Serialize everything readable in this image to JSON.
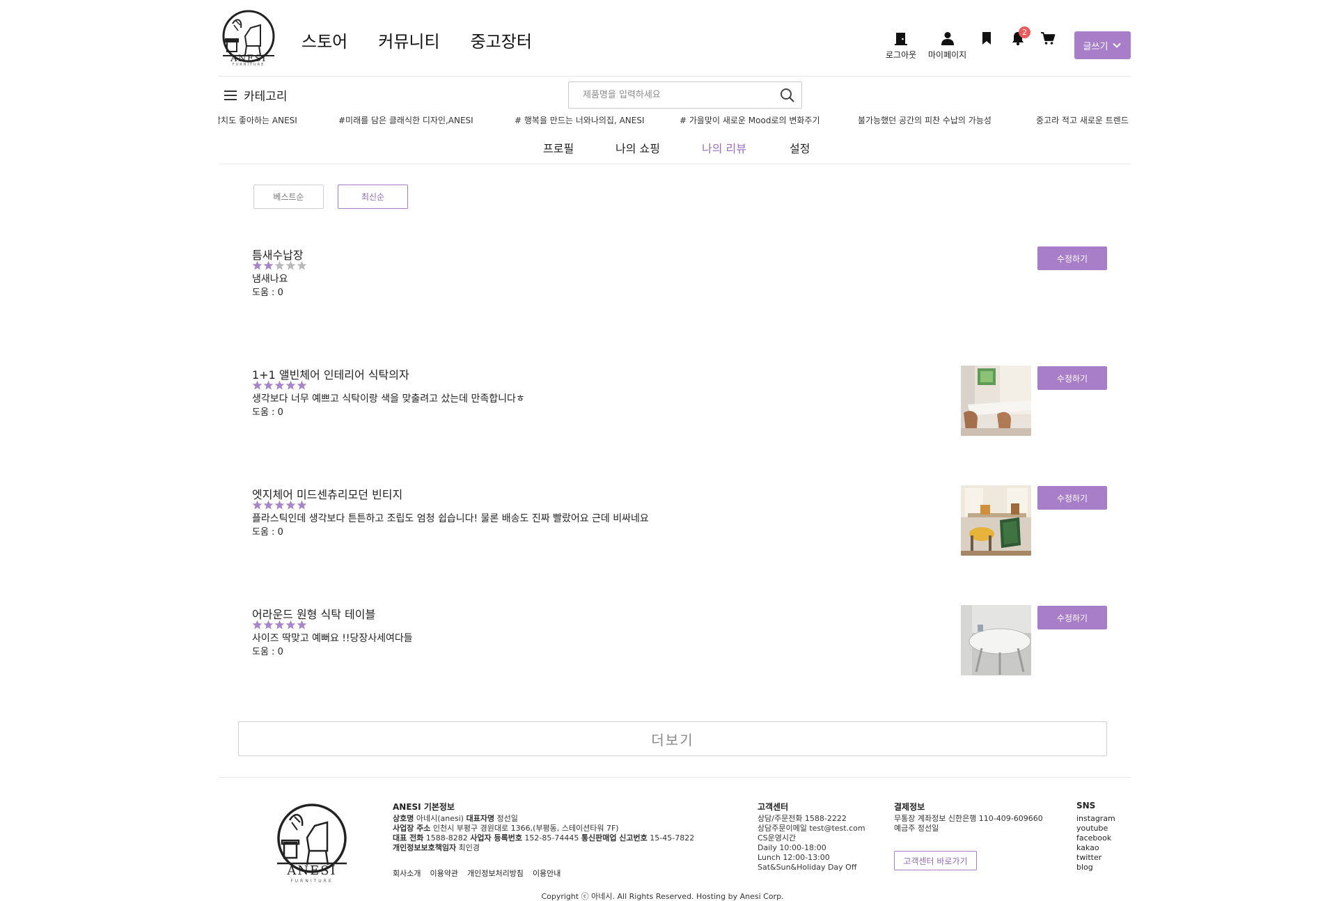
{
  "brand": {
    "logo_text": "ANESI",
    "logo_sub": "FURNITURE"
  },
  "nav": {
    "store": "스토어",
    "community": "커뮤니티",
    "used_market": "중고장터"
  },
  "utility": {
    "logout": "로그아웃",
    "mypage": "마이페이지",
    "notification_count": "2",
    "write": "글쓰기"
  },
  "category_label": "카테고리",
  "search": {
    "placeholder": "제품명을 입력하세요"
  },
  "ticker": [
    "갑치도 좋아하는 ANESI",
    "#미래를 담은 클래식한 디자인,ANESI",
    "# 행복을 만드는 너와나의집, ANESI",
    "# 가을맞이 새로운 Mood로의 변화주기",
    "불가능했던 공간의 피찬 수납의 가능성",
    "중고라 적고 새로운 트렌드"
  ],
  "mypage_tabs": [
    "프로필",
    "나의 쇼핑",
    "나의 리뷰",
    "설정"
  ],
  "sort": {
    "best": "베스트순",
    "latest": "최신순"
  },
  "reviews": [
    {
      "title": "틈새수납장",
      "rating": 2,
      "content": "냄새나요",
      "help": "도움 : 0",
      "edit": "수정하기",
      "has_image": false
    },
    {
      "title": "1+1 앨빈체어 인테리어 식탁의자",
      "rating": 5,
      "content": "생각보다 너무 예쁘고 식탁이랑 색을 맞출려고 샀는데 만족합니다ㅎ",
      "help": "도움 : 0",
      "edit": "수정하기",
      "has_image": true
    },
    {
      "title": "엣지체어 미드센츄리모던 빈티지",
      "rating": 5,
      "content": "플라스틱인데 생각보다 튼튼하고 조립도 엄청 쉽습니다! 물론 배송도 진짜 빨랐어요 근데 비싸네요",
      "help": "도움 : 0",
      "edit": "수정하기",
      "has_image": true
    },
    {
      "title": "어라운드 원형 식탁 테이블",
      "rating": 5,
      "content": "사이즈 딱맞고 예뻐요 !!당장사세여다들",
      "help": "도움 : 0",
      "edit": "수정하기",
      "has_image": true
    }
  ],
  "more_button": "더보기",
  "footer": {
    "company_heading": "ANESI 기본정보",
    "company_lines": [
      [
        [
          "b",
          "상호명"
        ],
        [
          "",
          " 아네시(anesi) "
        ],
        [
          "b",
          "대표자명"
        ],
        [
          "",
          " 정선일"
        ]
      ],
      [
        [
          "b",
          "사업장 주소"
        ],
        [
          "",
          " 인천시 부평구 경원대로 1366,(부평동, 스테이션타워 7F)"
        ]
      ],
      [
        [
          "b",
          "대표 전화"
        ],
        [
          "",
          " 1588-8282 "
        ],
        [
          "b",
          "사업자 등록번호"
        ],
        [
          "",
          " 152-85-74445 "
        ],
        [
          "b",
          "통신판매업 신고번호"
        ],
        [
          "",
          " 15-45-7822"
        ]
      ],
      [
        [
          "b",
          "개인정보보호책임자"
        ],
        [
          "",
          " 최인경"
        ]
      ]
    ],
    "links": [
      "회사소개",
      "이용약관",
      "개인정보처리방침",
      "이용안내"
    ],
    "cs_heading": "고객센터",
    "cs_lines": [
      "상담/주문전화 1588-2222",
      "상담주문이메일 test@test.com",
      "CS운영시간",
      "Daily 10:00-18:00",
      "Lunch 12:00-13:00",
      "Sat&Sun&Holiday Day Off"
    ],
    "pay_heading": "결제정보",
    "pay_lines": [
      "무통장 계좌정보 신한은행 110-409-609660",
      "예금주 정선일"
    ],
    "cs_button": "고객센터 바로가기",
    "sns_heading": "SNS",
    "sns": [
      "instagram",
      "youtube",
      "facebook",
      "kakao",
      "twitter",
      "blog"
    ],
    "copyright": "Copyright ⓒ 아네시. All Rights Reserved. Hosting by Anesi Corp."
  },
  "colors": {
    "accent": "#a97ec9",
    "active_tab": "#9b6cc0",
    "badge": "#ea5b5b",
    "star_on": "#a785c9",
    "star_off": "#b9b9b9"
  }
}
